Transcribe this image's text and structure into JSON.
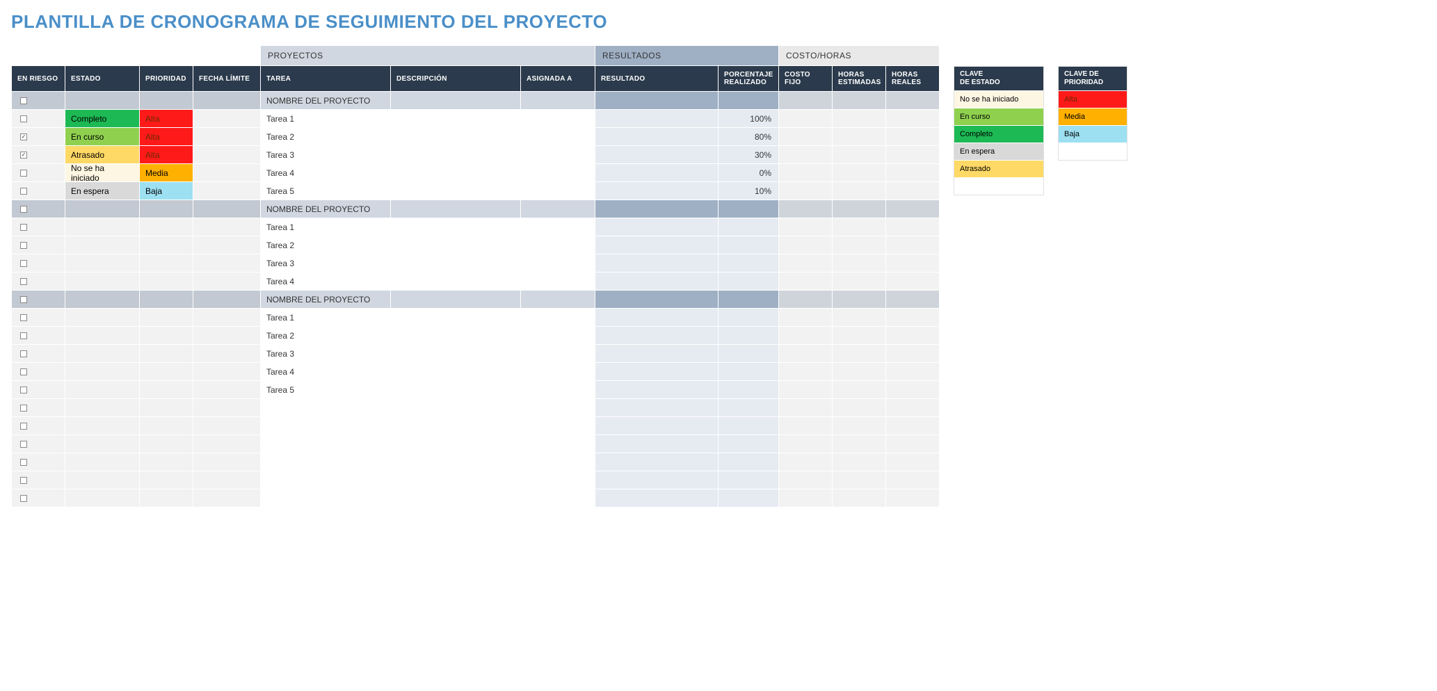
{
  "title": "PLANTILLA DE CRONOGRAMA DE SEGUIMIENTO DEL PROYECTO",
  "sections": {
    "proyectos": "PROYECTOS",
    "resultados": "RESULTADOS",
    "costo_horas": "COSTO/HORAS"
  },
  "columns": {
    "en_riesgo": "EN RIESGO",
    "estado": "ESTADO",
    "prioridad": "PRIORIDAD",
    "fecha_limite": "FECHA LÍMITE",
    "tarea": "TAREA",
    "descripcion": "DESCRIPCIÓN",
    "asignada_a": "ASIGNADA A",
    "resultado": "RESULTADO",
    "porcentaje": "PORCENTAJE REALIZADO",
    "costo_fijo": "COSTO FIJO",
    "horas_est": "HORAS ESTIMADAS",
    "horas_real": "HORAS REALES"
  },
  "rows": [
    {
      "type": "group",
      "checked": false,
      "tarea": "NOMBRE DEL PROYECTO"
    },
    {
      "type": "task",
      "checked": false,
      "estado": "Completo",
      "estado_cls": "st-completo",
      "prioridad": "Alta",
      "prioridad_cls": "pr-alta",
      "tarea": "Tarea 1",
      "pct": "100%"
    },
    {
      "type": "task",
      "checked": true,
      "estado": "En curso",
      "estado_cls": "st-encurso",
      "prioridad": "Alta",
      "prioridad_cls": "pr-alta",
      "tarea": "Tarea 2",
      "pct": "80%"
    },
    {
      "type": "task",
      "checked": true,
      "estado": "Atrasado",
      "estado_cls": "st-atrasado",
      "prioridad": "Alta",
      "prioridad_cls": "pr-alta",
      "tarea": "Tarea 3",
      "pct": "30%"
    },
    {
      "type": "task",
      "checked": false,
      "estado": "No se ha iniciado",
      "estado_cls": "st-nose",
      "prioridad": "Media",
      "prioridad_cls": "pr-media",
      "tarea": "Tarea 4",
      "pct": "0%"
    },
    {
      "type": "task",
      "checked": false,
      "estado": "En espera",
      "estado_cls": "st-espera",
      "prioridad": "Baja",
      "prioridad_cls": "pr-baja",
      "tarea": "Tarea 5",
      "pct": "10%"
    },
    {
      "type": "group",
      "checked": false,
      "tarea": "NOMBRE DEL PROYECTO"
    },
    {
      "type": "task",
      "checked": false,
      "tarea": "Tarea 1"
    },
    {
      "type": "task",
      "checked": false,
      "tarea": "Tarea 2"
    },
    {
      "type": "task",
      "checked": false,
      "tarea": "Tarea 3"
    },
    {
      "type": "task",
      "checked": false,
      "tarea": "Tarea 4"
    },
    {
      "type": "group",
      "checked": false,
      "tarea": "NOMBRE DEL PROYECTO"
    },
    {
      "type": "task",
      "checked": false,
      "tarea": "Tarea 1"
    },
    {
      "type": "task",
      "checked": false,
      "tarea": "Tarea 2"
    },
    {
      "type": "task",
      "checked": false,
      "tarea": "Tarea 3"
    },
    {
      "type": "task",
      "checked": false,
      "tarea": "Tarea 4"
    },
    {
      "type": "task",
      "checked": false,
      "tarea": "Tarea 5"
    },
    {
      "type": "task",
      "checked": false
    },
    {
      "type": "task",
      "checked": false
    },
    {
      "type": "task",
      "checked": false
    },
    {
      "type": "task",
      "checked": false
    },
    {
      "type": "task",
      "checked": false
    },
    {
      "type": "task",
      "checked": false
    }
  ],
  "legend_estado": {
    "title": "CLAVE\nDE ESTADO",
    "items": [
      {
        "label": "No se ha iniciado",
        "cls": "st-nose"
      },
      {
        "label": "En curso",
        "cls": "st-encurso"
      },
      {
        "label": "Completo",
        "cls": "st-completo"
      },
      {
        "label": "En espera",
        "cls": "st-espera"
      },
      {
        "label": "Atrasado",
        "cls": "st-atrasado"
      }
    ]
  },
  "legend_prioridad": {
    "title": "CLAVE DE PRIORIDAD",
    "items": [
      {
        "label": "Alta",
        "cls": "pr-alta"
      },
      {
        "label": "Media",
        "cls": "pr-media"
      },
      {
        "label": "Baja",
        "cls": "pr-baja"
      }
    ]
  },
  "col_widths": {
    "en_riesgo": 76,
    "estado": 106,
    "prioridad": 76,
    "fecha_limite": 96,
    "tarea": 186,
    "descripcion": 186,
    "asignada_a": 106,
    "resultado": 176,
    "porcentaje": 86,
    "costo_fijo": 76,
    "horas_est": 76,
    "horas_real": 76
  }
}
